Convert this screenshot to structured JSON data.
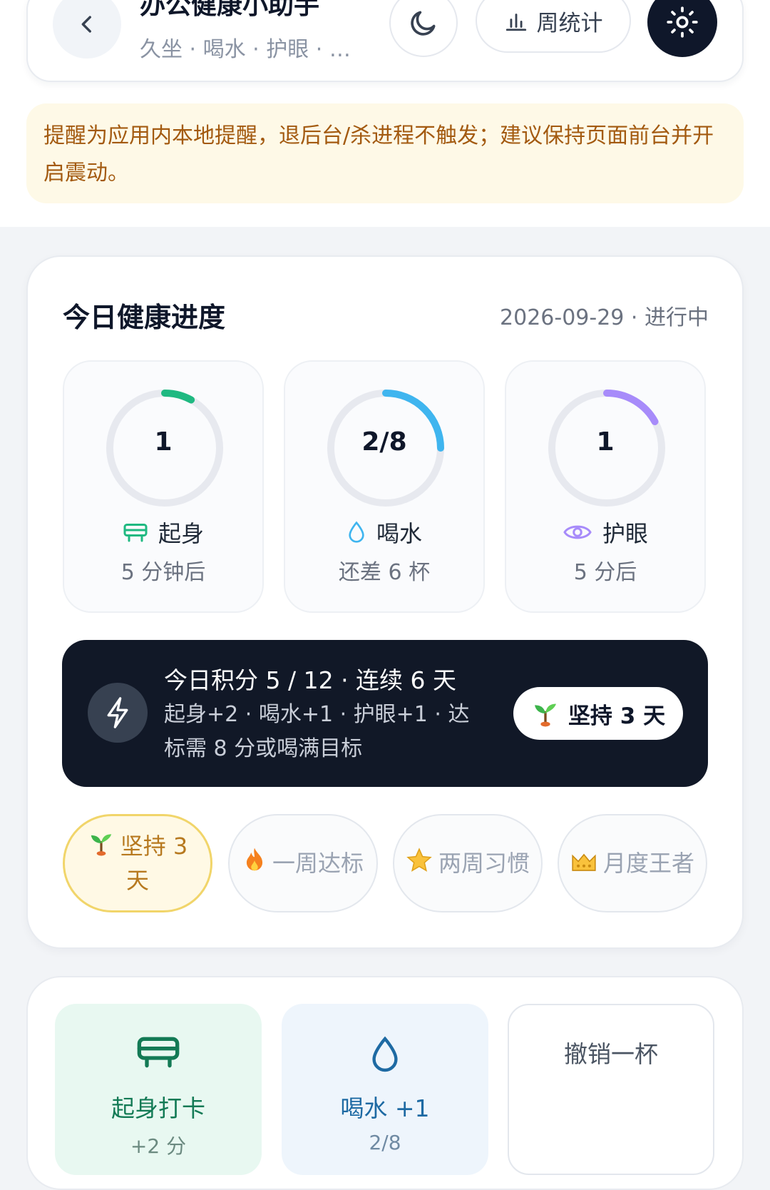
{
  "header": {
    "title": "办公健康小助手",
    "subtitle": "久坐 · 喝水 · 护眼 · …",
    "week_stats_label": "周统计"
  },
  "notice": {
    "text": "提醒为应用内本地提醒，退后台/杀进程不触发；建议保持页面前台并开启震动。"
  },
  "progress": {
    "title": "今日健康进度",
    "date_status": "2026-09-29 · 进行中",
    "metrics": [
      {
        "value": "1",
        "label": "起身",
        "sub": "5 分钟后",
        "fraction": 0.08,
        "color": "#1fb981",
        "icon": "stand-desk-icon"
      },
      {
        "value": "2/8",
        "label": "喝水",
        "sub": "还差 6 杯",
        "fraction": 0.25,
        "color": "#3fb5ef",
        "icon": "water-drop-icon"
      },
      {
        "value": "1",
        "label": "护眼",
        "sub": "5 分后",
        "fraction": 0.17,
        "color": "#a78bfa",
        "icon": "eye-icon"
      }
    ]
  },
  "score": {
    "main": "今日积分 5 / 12 · 连续 6 天",
    "detail": "起身+2 · 喝水+1 · 护眼+1 · 达标需 8 分或喝满目标",
    "streak_pill": "坚持 3 天"
  },
  "badges": [
    {
      "label": "坚持 3 天",
      "icon": "sprout-icon",
      "active": true
    },
    {
      "label": "一周达标",
      "icon": "fire-icon",
      "active": false
    },
    {
      "label": "两周习惯",
      "icon": "star-icon",
      "active": false
    },
    {
      "label": "月度王者",
      "icon": "crown-icon",
      "active": false
    }
  ],
  "actions": {
    "stand": {
      "label": "起身打卡",
      "sub": "+2 分"
    },
    "water": {
      "label": "喝水 +1",
      "sub": "2/8"
    },
    "undo": {
      "label": "撤销一杯"
    }
  }
}
